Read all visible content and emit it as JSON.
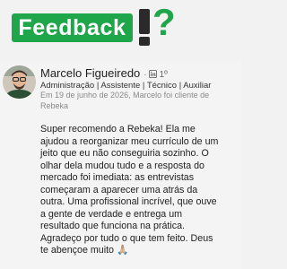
{
  "banner": {
    "title": "Feedback",
    "exclamation_icon": "exclamation-icon",
    "question_mark": "?",
    "color_green": "#1fa54a",
    "color_dark": "#2a2a2a"
  },
  "post": {
    "author_name": "Marcelo Figueiredo",
    "separator": "·",
    "network_icon": "linkedin-icon",
    "connection_degree": "1º",
    "headline": "Administração | Assistente | Técnico | Auxiliar",
    "meta": "Em 19 de junho de 2026, Marcelo foi cliente de Rebeka",
    "body": "Super recomendo a Rebeka! Ela me\najudou a reorganizar meu currículo de um\njeito que eu não conseguiria sozinho. O\nolhar dela mudou tudo e a resposta do\nmercado foi imediata: as entrevistas\ncomeçaram a aparecer uma atrás da\noutra. Uma profissional incrível, que ouve\na gente de verdade e entrega um\nresultado que funciona na prática.\nAgradeço por tudo o que tem feito. Deus\nte abençoe muito 🙏🏼"
  }
}
